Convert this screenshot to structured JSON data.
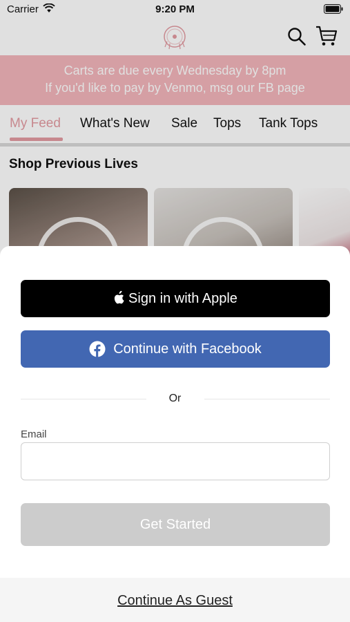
{
  "status_bar": {
    "carrier": "Carrier",
    "time": "9:20 PM"
  },
  "header": {
    "logo": "store-logo",
    "icons": [
      "search-icon",
      "cart-icon"
    ]
  },
  "announcement": {
    "line1": "Carts are due every Wednesday by 8pm",
    "line2": "If you'd like to pay by Venmo, msg our FB page"
  },
  "tabs": [
    {
      "label": "My Feed",
      "active": true
    },
    {
      "label": "What's New"
    },
    {
      "label": "Sale"
    },
    {
      "label": "Tops"
    },
    {
      "label": "Tank Tops"
    }
  ],
  "section": {
    "title": "Shop Previous Lives"
  },
  "sheet": {
    "apple_button": "Sign in with Apple",
    "facebook_button": "Continue with Facebook",
    "or_text": "Or",
    "email_label": "Email",
    "email_value": "",
    "email_placeholder": "",
    "get_started_button": "Get Started",
    "guest_link": "Continue As Guest"
  },
  "colors": {
    "accent_pink": "#e39ba2",
    "announcement_bg": "#f3b6bb",
    "facebook_blue": "#4267b2",
    "apple_black": "#000000",
    "disabled_gray": "#cccccc"
  }
}
